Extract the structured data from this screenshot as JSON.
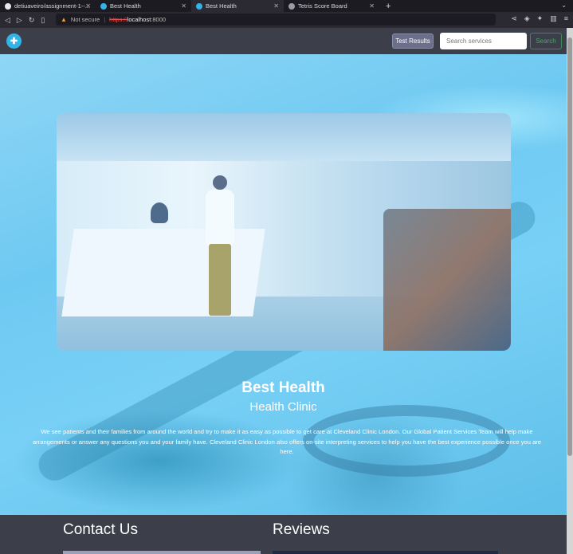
{
  "browser": {
    "tabs": [
      {
        "label": "detiuaveiro/assignment-1--...",
        "active": false,
        "icon": "github-icon"
      },
      {
        "label": "Best Health",
        "active": false,
        "icon": "site-logo-icon"
      },
      {
        "label": "Best Health",
        "active": true,
        "icon": "site-logo-icon"
      },
      {
        "label": "Tetris Score Board",
        "active": false,
        "icon": "globe-icon"
      }
    ],
    "url": {
      "security_label": "Not secure",
      "scheme": "https://",
      "host": "localhost",
      "port": ":8000"
    }
  },
  "navbar": {
    "test_results_label": "Test Results",
    "search_placeholder": "Search services",
    "search_button_label": "Search"
  },
  "hero": {
    "title": "Best Health",
    "subtitle": "Health Clinic",
    "description": "We see patients and their families from around the world and try to make it as easy as possible to get care at Cleveland Clinic London. Our Global Patient Services Team will help make arrangements or answer any questions you and your family have. Cleveland Clinic London also offers on-site interpreting services to help you have the best experience possible once you are here."
  },
  "footer": {
    "contact_heading": "Contact Us",
    "reviews_heading": "Reviews"
  },
  "colors": {
    "navbar": "#3c3f4a",
    "hero_tint": "#6ec9f2",
    "search_button": "#4aa36a"
  }
}
